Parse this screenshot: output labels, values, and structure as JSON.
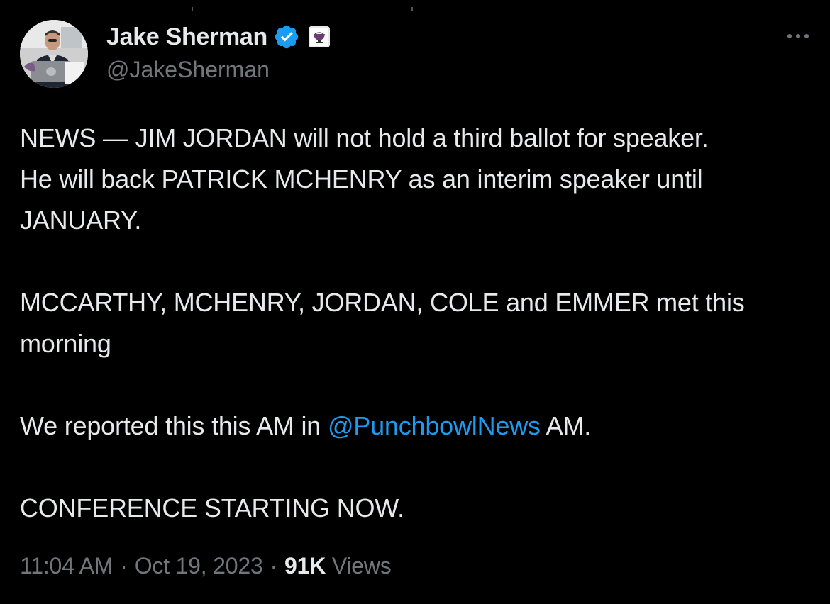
{
  "author": {
    "display_name": "Jake Sherman",
    "handle": "@JakeSherman",
    "verified_icon": "verified-badge-icon",
    "affiliation_icon": "punchbowl-affiliate-icon"
  },
  "tweet": {
    "line1": "NEWS — JIM JORDAN will not hold a third ballot for speaker.",
    "line2": "He will back PATRICK MCHENRY as an interim speaker until",
    "line3": "JANUARY.",
    "line4": "MCCARTHY, MCHENRY, JORDAN, COLE and EMMER met this",
    "line5": "morning",
    "line6_before": "We reported this this AM in ",
    "line6_mention": "@PunchbowlNews",
    "line6_after": " AM.",
    "line7": "CONFERENCE STARTING NOW."
  },
  "meta": {
    "time": "11:04 AM",
    "separator": "·",
    "date": "Oct 19, 2023",
    "views_count": "91K",
    "views_label": "Views"
  },
  "colors": {
    "background": "#000000",
    "text": "#e7e9ea",
    "secondary": "#71767b",
    "link": "#1d9bf0",
    "verified": "#1d9bf0"
  }
}
